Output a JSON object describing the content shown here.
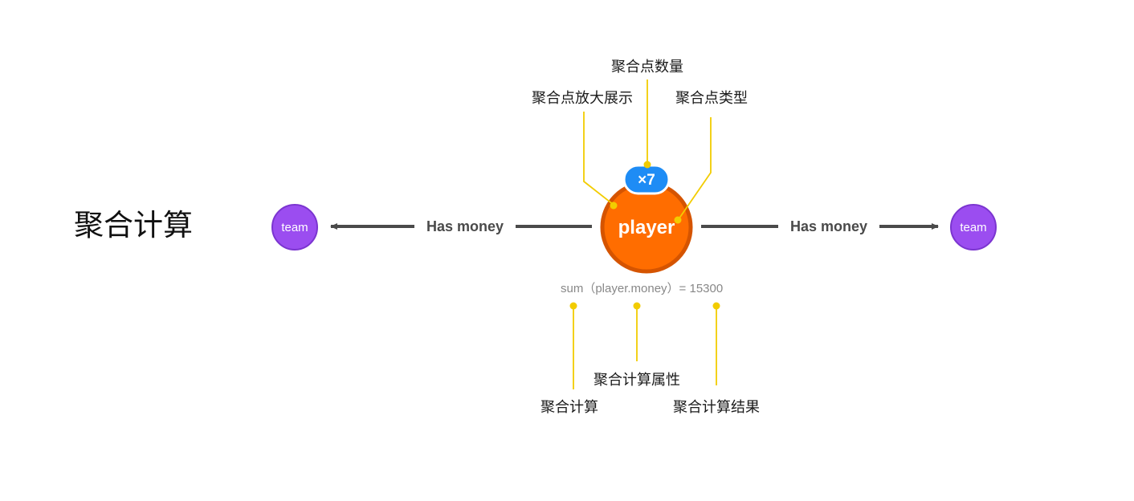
{
  "heading": "聚合计算",
  "nodes": {
    "center": {
      "label": "player",
      "count_badge": "×7",
      "fill": "#FF6D00",
      "stroke": "#D55400",
      "badge_fill": "#1E8CF5"
    },
    "left": {
      "label": "team",
      "fill": "#9B4DF0",
      "stroke": "#7B35D0"
    },
    "right": {
      "label": "team",
      "fill": "#9B4DF0",
      "stroke": "#7B35D0"
    }
  },
  "edges": {
    "left_label": "Has money",
    "right_label": "Has money",
    "color": "#4a4a4a"
  },
  "aggregation_text": "sum（player.money）= 15300",
  "annotations": {
    "count": "聚合点数量",
    "zoom": "聚合点放大展示",
    "type": "聚合点类型",
    "agg_calc": "聚合计算",
    "agg_property": "聚合计算属性",
    "agg_result": "聚合计算结果",
    "leader_color": "#F2CC00"
  }
}
